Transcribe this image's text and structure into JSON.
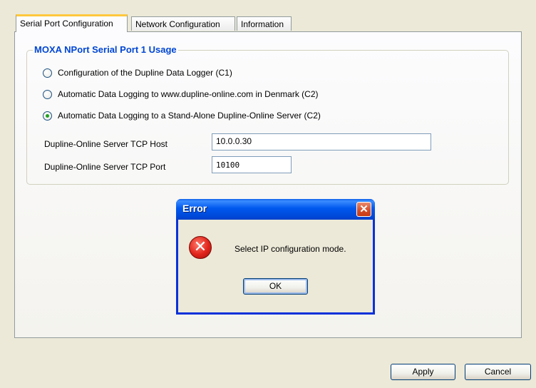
{
  "tabs": [
    {
      "label": "Serial Port Configuration",
      "active": true
    },
    {
      "label": "Network Configuration",
      "active": false
    },
    {
      "label": "Information",
      "active": false
    }
  ],
  "group": {
    "title": "MOXA NPort Serial Port 1 Usage",
    "options": [
      {
        "label": "Configuration of the Dupline Data Logger (C1)",
        "checked": false
      },
      {
        "label": "Automatic Data Logging to www.dupline-online.com in Denmark (C2)",
        "checked": false
      },
      {
        "label": "Automatic Data Logging to a Stand-Alone Dupline-Online Server (C2)",
        "checked": true
      }
    ],
    "tcp_host_label": "Dupline-Online Server TCP Host",
    "tcp_host_value": "10.0.0.30",
    "tcp_port_label": "Dupline-Online Server TCP Port",
    "tcp_port_value": "10100"
  },
  "dialog": {
    "title": "Error",
    "close_glyph": "✕",
    "icon": "error-icon",
    "icon_glyph": "✕",
    "message": "Select IP configuration mode.",
    "ok_label": "OK"
  },
  "buttons": {
    "apply_label": "Apply",
    "cancel_label": "Cancel"
  },
  "colors": {
    "title_bar": "#0054e3",
    "group_title": "#0046d5",
    "active_tab_accent": "#ffc83c",
    "radio_checked": "#21a121"
  }
}
